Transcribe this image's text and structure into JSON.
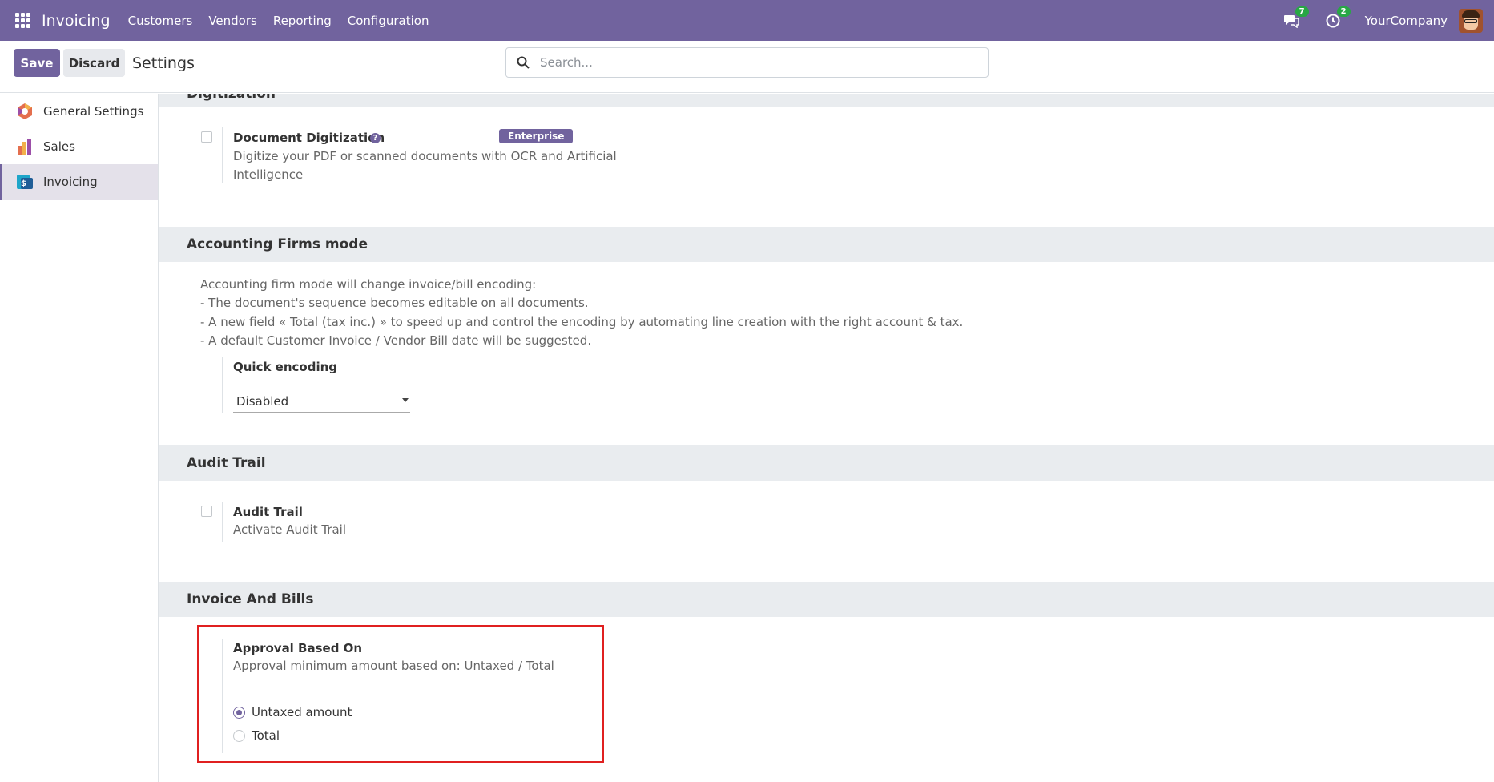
{
  "navbar": {
    "brand": "Invoicing",
    "menu": [
      "Customers",
      "Vendors",
      "Reporting",
      "Configuration"
    ],
    "messages_badge": "7",
    "activities_badge": "2",
    "company": "YourCompany"
  },
  "control_panel": {
    "save_label": "Save",
    "discard_label": "Discard",
    "title": "Settings",
    "search_placeholder": "Search..."
  },
  "sidebar": {
    "items": [
      {
        "label": "General Settings",
        "icon": "general-settings-icon",
        "active": false
      },
      {
        "label": "Sales",
        "icon": "sales-icon",
        "active": false
      },
      {
        "label": "Invoicing",
        "icon": "invoicing-icon",
        "active": true
      }
    ]
  },
  "sections": {
    "digitization": {
      "header": "Digitization",
      "setting_label": "Document Digitization",
      "badge": "Enterprise",
      "description": "Digitize your PDF or scanned documents with OCR and Artificial Intelligence"
    },
    "accounting_firms": {
      "header": "Accounting Firms mode",
      "lines": [
        "Accounting firm mode will change invoice/bill encoding:",
        "- The document's sequence becomes editable on all documents.",
        "- A new field « Total (tax inc.) » to speed up and control the encoding by automating line creation with the right account & tax.",
        "- A default Customer Invoice / Vendor Bill date will be suggested."
      ],
      "quick_encoding_label": "Quick encoding",
      "quick_encoding_value": "Disabled"
    },
    "audit_trail": {
      "header": "Audit Trail",
      "setting_label": "Audit Trail",
      "description": "Activate Audit Trail"
    },
    "invoice_bills": {
      "header": "Invoice And Bills",
      "setting_label": "Approval Based On",
      "description": "Approval minimum amount based on: Untaxed / Total",
      "options": [
        "Untaxed amount",
        "Total"
      ],
      "selected": "Untaxed amount"
    }
  },
  "colors": {
    "brand": "#71639e",
    "badge_green": "#28a745",
    "highlight_red": "#e02020"
  }
}
